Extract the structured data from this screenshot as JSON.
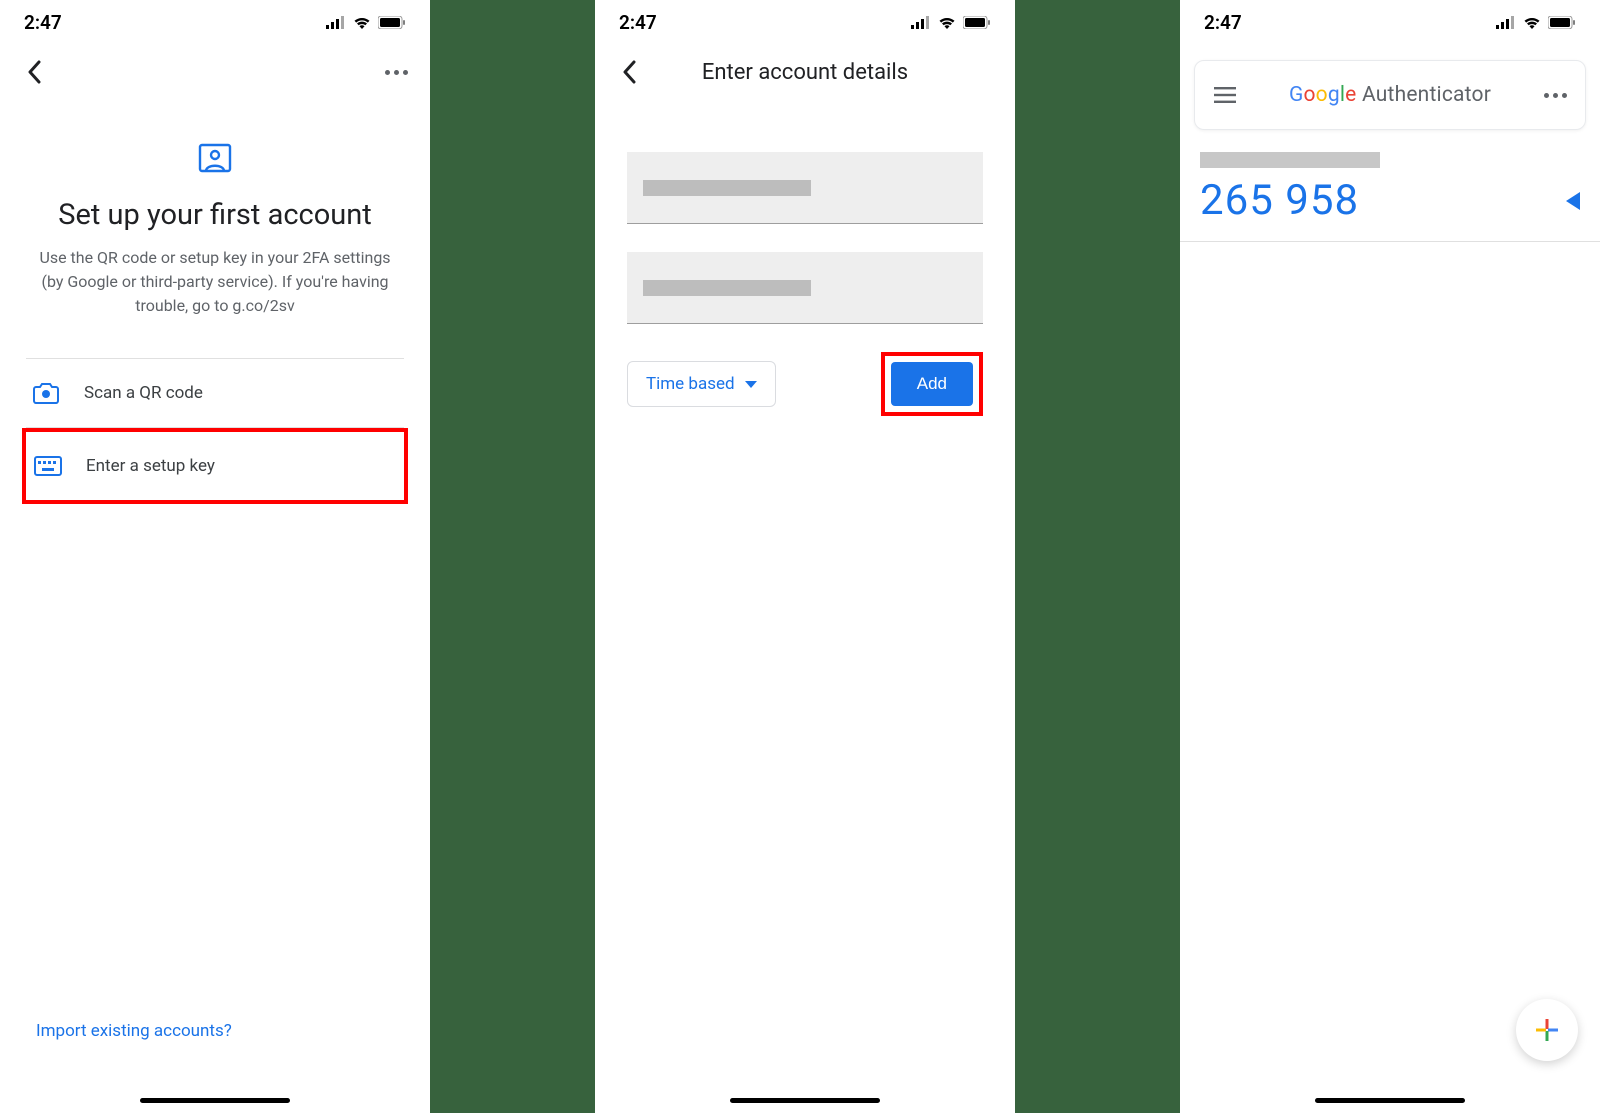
{
  "status": {
    "time": "2:47"
  },
  "screen1": {
    "title": "Set up your first account",
    "subtitle": "Use the QR code or setup key in your 2FA settings (by Google or third-party service). If you're having trouble, go to g.co/2sv",
    "options": {
      "scan": "Scan a QR code",
      "key": "Enter a setup key"
    },
    "import_link": "Import existing accounts?"
  },
  "screen2": {
    "nav_title": "Enter account details",
    "dropdown_label": "Time based",
    "add_label": "Add"
  },
  "screen3": {
    "app_name_plain": "Authenticator",
    "code": "265 958"
  }
}
